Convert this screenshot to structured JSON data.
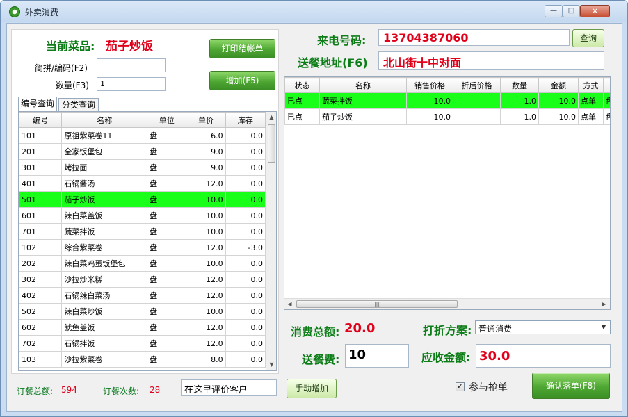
{
  "window": {
    "title": "外卖消费",
    "min_label": "—",
    "max_label": "□",
    "close_label": "✕"
  },
  "left": {
    "current_dish_label": "当前菜品:",
    "current_dish_value": "茄子炒饭",
    "pinyin_label": "简拼/编码(F2)",
    "pinyin_value": "",
    "qty_label": "数量(F3)",
    "qty_value": "1",
    "print_button": "打印结帐单",
    "add_button": "增加(F5)",
    "tabs": [
      "编号查询",
      "分类查询"
    ],
    "menu_table": {
      "headers": [
        "编号",
        "名称",
        "单位",
        "单价",
        "库存"
      ],
      "rows": [
        [
          "101",
          "原祖紫菜卷11",
          "盘",
          "6.0",
          "0.0"
        ],
        [
          "201",
          "全家饭堡包",
          "盘",
          "9.0",
          "0.0"
        ],
        [
          "301",
          "烤拉面",
          "盘",
          "9.0",
          "0.0"
        ],
        [
          "401",
          "石锅酱汤",
          "盘",
          "12.0",
          "0.0"
        ],
        [
          "501",
          "茄子炒饭",
          "盘",
          "10.0",
          "0.0"
        ],
        [
          "601",
          "辣白菜盖饭",
          "盘",
          "10.0",
          "0.0"
        ],
        [
          "701",
          "蔬菜拌饭",
          "盘",
          "10.0",
          "0.0"
        ],
        [
          "102",
          "综合紫菜卷",
          "盘",
          "12.0",
          "-3.0"
        ],
        [
          "202",
          "辣白菜鸡蛋饭堡包",
          "盘",
          "10.0",
          "0.0"
        ],
        [
          "302",
          "沙拉炒米糕",
          "盘",
          "12.0",
          "0.0"
        ],
        [
          "402",
          "石锅辣白菜汤",
          "盘",
          "12.0",
          "0.0"
        ],
        [
          "502",
          "辣白菜炒饭",
          "盘",
          "10.0",
          "0.0"
        ],
        [
          "602",
          "鱿鱼盖饭",
          "盘",
          "12.0",
          "0.0"
        ],
        [
          "702",
          "石锅拌饭",
          "盘",
          "12.0",
          "0.0"
        ],
        [
          "103",
          "沙拉紫菜卷",
          "盘",
          "8.0",
          "0.0"
        ]
      ]
    }
  },
  "right": {
    "phone_label": "来电号码:",
    "phone_value": "13704387060",
    "query_button": "查询",
    "address_label": "送餐地址(F6)",
    "address_value": "北山街十中对面",
    "order_table": {
      "headers": [
        "状态",
        "名称",
        "销售价格",
        "折后价格",
        "数量",
        "金额",
        "方式",
        ""
      ],
      "rows": [
        [
          "已点",
          "蔬菜拌饭",
          "10.0",
          "",
          "1.0",
          "10.0",
          "点单",
          "盘"
        ],
        [
          "已点",
          "茄子炒饭",
          "10.0",
          "",
          "1.0",
          "10.0",
          "点单",
          "盘"
        ]
      ]
    },
    "total_label": "消费总额:",
    "total_value": "20.0",
    "discount_label": "打折方案:",
    "discount_value": "普通消费",
    "delivery_fee_label": "送餐费:",
    "delivery_fee_value": "10",
    "receivable_label": "应收金额:",
    "receivable_value": "30.0",
    "grab_label": "参与抢单",
    "confirm_button": "确认落单(F8)"
  },
  "footer": {
    "order_total_label": "订餐总额:",
    "order_total_value": "594",
    "order_count_label": "订餐次数:",
    "order_count_value": "28",
    "comment_value": "在这里评价客户",
    "manual_add_button": "手动增加"
  },
  "colors": {
    "selected_row": "#1aff1a",
    "accent_red": "#e0001a",
    "accent_green": "#0c7d17"
  }
}
